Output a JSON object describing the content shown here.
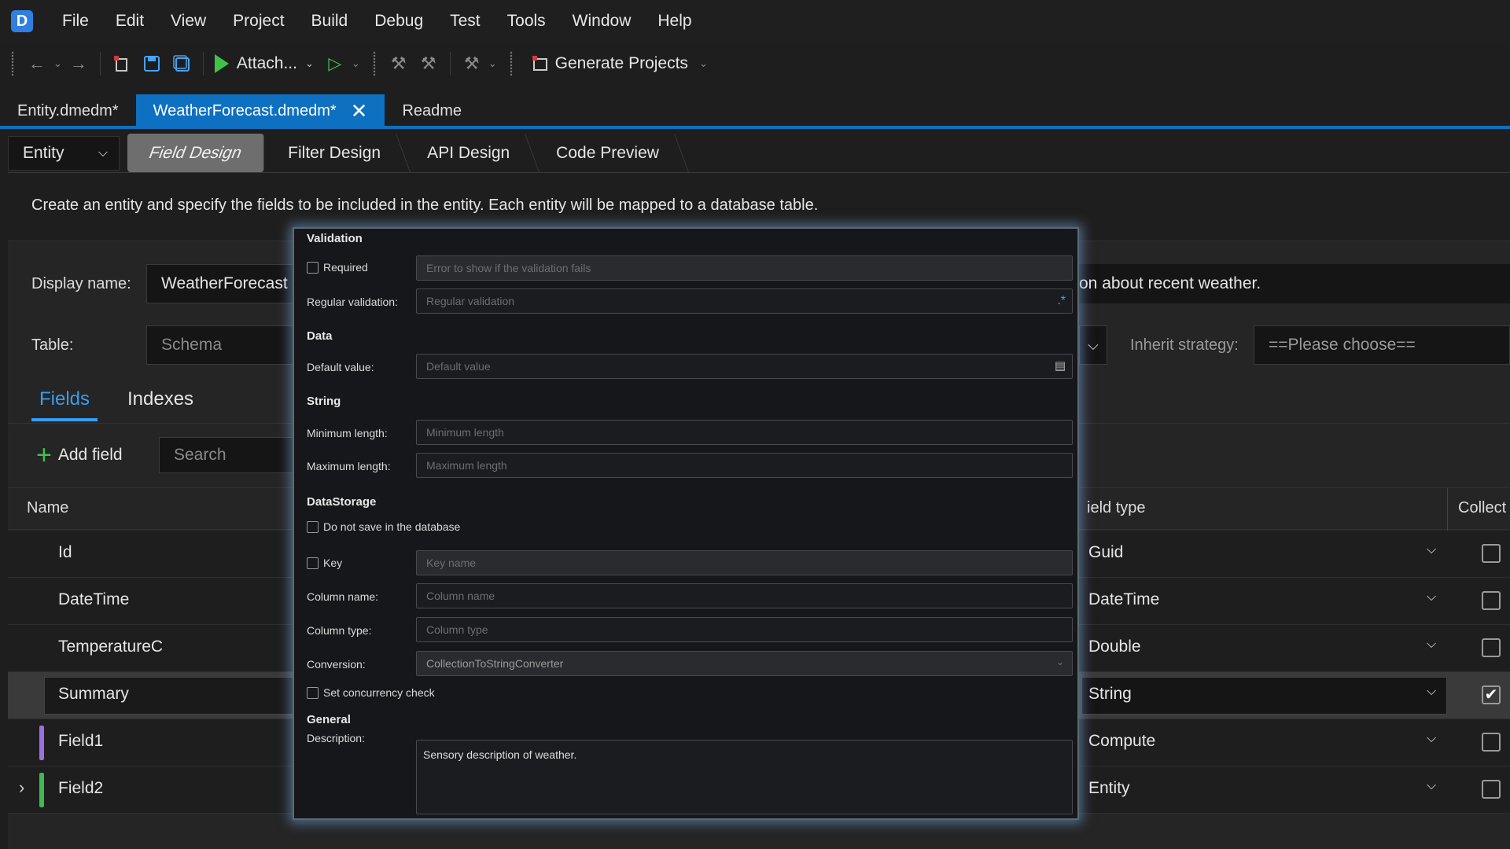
{
  "menu": {
    "logo": "D",
    "items": [
      "File",
      "Edit",
      "View",
      "Project",
      "Build",
      "Debug",
      "Test",
      "Tools",
      "Window",
      "Help"
    ]
  },
  "toolbar": {
    "attach_label": "Attach...",
    "generate_label": "Generate Projects"
  },
  "doc_tabs": [
    {
      "label": "Entity.dmedm*"
    },
    {
      "label": "WeatherForecast.dmedm*"
    },
    {
      "label": "Readme"
    }
  ],
  "designer": {
    "entity_select": "Entity",
    "tabs": [
      "Field Design",
      "Filter Design",
      "API Design",
      "Code Preview"
    ],
    "description": "Create an entity and specify the fields to be included in the entity.  Each entity will be mapped to a database table."
  },
  "form": {
    "display_name_label": "Display name:",
    "display_name_value": "WeatherForecast",
    "description_tail": "on about recent weather.",
    "table_label": "Table:",
    "schema_placeholder": "Schema",
    "inherit_label": "Inherit strategy:",
    "inherit_value": "==Please choose=="
  },
  "sub_tabs": [
    "Fields",
    "Indexes"
  ],
  "fields_toolbar": {
    "add_label": "Add field",
    "search_placeholder": "Search"
  },
  "grid": {
    "col_name": "Name",
    "col_field_type": "ield type",
    "col_collect": "Collect",
    "rows": [
      {
        "name": "Id",
        "type": "Guid",
        "checked": false
      },
      {
        "name": "DateTime",
        "type": "DateTime",
        "checked": false
      },
      {
        "name": "TemperatureC",
        "type": "Double",
        "checked": false
      },
      {
        "name": "Summary",
        "type": "String",
        "checked": true
      },
      {
        "name": "Field1",
        "type": "Compute",
        "checked": false,
        "marker": "#9b6fe0"
      },
      {
        "name": "Field2",
        "type": "Entity",
        "checked": false,
        "marker": "#3fb950"
      }
    ]
  },
  "popup": {
    "validation": {
      "title": "Validation",
      "required_label": "Required",
      "required_placeholder": "Error to show if the validation fails",
      "regular_label": "Regular validation:",
      "regular_placeholder": "Regular validation"
    },
    "data": {
      "title": "Data",
      "default_label": "Default value:",
      "default_placeholder": "Default value"
    },
    "string": {
      "title": "String",
      "min_label": "Minimum length:",
      "min_placeholder": "Minimum length",
      "max_label": "Maximum length:",
      "max_placeholder": "Maximum length"
    },
    "storage": {
      "title": "DataStorage",
      "no_save_label": "Do not save in the database",
      "key_label": "Key",
      "key_placeholder": "Key name",
      "column_name_label": "Column name:",
      "column_name_placeholder": "Column name",
      "column_type_label": "Column type:",
      "column_type_placeholder": "Column type",
      "conversion_label": "Conversion:",
      "conversion_value": "CollectionToStringConverter",
      "concurrency_label": "Set concurrency check"
    },
    "general": {
      "title": "General",
      "description_label": "Description:",
      "description_value": "Sensory description of weather."
    }
  },
  "colors": {
    "accent": "#0e70c0",
    "green": "#3fc24a",
    "link_blue": "#3b9cf0"
  }
}
